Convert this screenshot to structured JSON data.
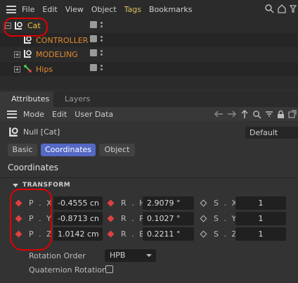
{
  "menubar": {
    "items": [
      "File",
      "Edit",
      "View",
      "Object",
      "Tags",
      "Bookmarks"
    ]
  },
  "objects": [
    {
      "name": "Cat",
      "icon": "null-icon",
      "selected": true
    },
    {
      "name": "CONTROLLER",
      "icon": "null-icon"
    },
    {
      "name": "MODELING",
      "icon": "null-icon"
    },
    {
      "name": "Hips",
      "icon": "joint-icon"
    }
  ],
  "tabs": {
    "attributes": "Attributes",
    "layers": "Layers"
  },
  "attr_menu": {
    "mode": "Mode",
    "edit": "Edit",
    "user_data": "User Data"
  },
  "object_title": "Null [Cat]",
  "layer_dropdown": "Default",
  "mode_buttons": {
    "basic": "Basic",
    "coordinates": "Coordinates",
    "object": "Object",
    "active": "Coordinates"
  },
  "section_title": "Coordinates",
  "transform": {
    "heading": "TRANSFORM",
    "rows": [
      {
        "p_label": "P . X",
        "p_value": "-0.4555 cn",
        "r_label": "R . H",
        "r_value": "2.9079 °",
        "s_label": "S . X",
        "s_value": "1"
      },
      {
        "p_label": "P . Y",
        "p_value": "-0.8713 cn",
        "r_label": "R . P",
        "r_value": "0.1027 °",
        "s_label": "S . Y",
        "s_value": "1"
      },
      {
        "p_label": "P . Z",
        "p_value": "1.0142 cm",
        "r_label": "R . B",
        "r_value": "0.2211 °",
        "s_label": "S . Z",
        "s_value": "1"
      }
    ],
    "rotation_order_label": "Rotation Order",
    "rotation_order_value": "HPB",
    "quaternion_label": "Quaternion Rotation",
    "quaternion_checked": false
  },
  "colors": {
    "accent": "#5468c4",
    "object_name": "#e08a2e",
    "keyframe": "#e04040",
    "annotation": "#e00000"
  }
}
